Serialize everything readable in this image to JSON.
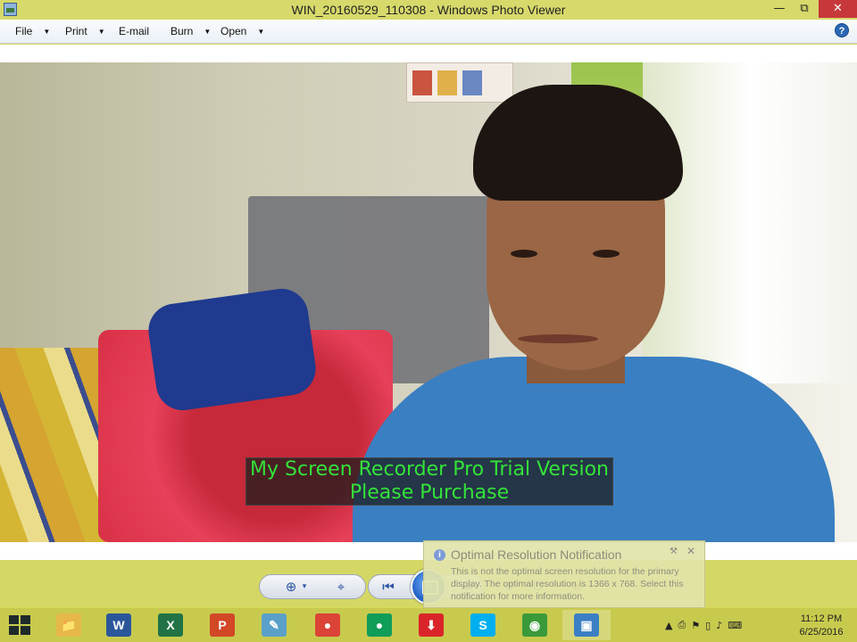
{
  "window": {
    "title": "WIN_20160529_110308 - Windows Photo Viewer",
    "minimize_glyph": "—",
    "maximize_glyph": "⧉",
    "close_glyph": "✕"
  },
  "menu": {
    "items": [
      {
        "label": "File",
        "has_arrow": true
      },
      {
        "label": "Print",
        "has_arrow": true
      },
      {
        "label": "E-mail",
        "has_arrow": false
      },
      {
        "label": "Burn",
        "has_arrow": true
      },
      {
        "label": "Open",
        "has_arrow": true
      }
    ],
    "arrow_glyph": "▼",
    "help_glyph": "?"
  },
  "watermark": {
    "line1": "My Screen Recorder Pro Trial Version",
    "line2": "Please Purchase"
  },
  "toolbar": {
    "zoom_icon": "⊕",
    "zoom_arrow": "▾",
    "fit_icon": "⌖",
    "prev_icon": "⏮",
    "next_icon": "⏭",
    "rotate_ccw_icon": "↺",
    "rotate_cw_icon": "↻",
    "delete_icon": "✕"
  },
  "notification": {
    "title": "Optimal Resolution Notification",
    "body": "This is not the optimal screen resolution for the primary display. The optimal resolution is 1366 x 768. Select this notification for more information.",
    "info_glyph": "i",
    "pin_glyph": "⚒",
    "close_glyph": "✕"
  },
  "taskbar": {
    "apps": [
      {
        "name": "file-explorer",
        "glyph": "📁",
        "color": "#e6b84a"
      },
      {
        "name": "word",
        "glyph": "W",
        "color": "#2b579a"
      },
      {
        "name": "excel",
        "glyph": "X",
        "color": "#217346"
      },
      {
        "name": "powerpoint",
        "glyph": "P",
        "color": "#d24726"
      },
      {
        "name": "notepad",
        "glyph": "✎",
        "color": "#5aa0c8"
      },
      {
        "name": "chrome",
        "glyph": "●",
        "color": "#db4437"
      },
      {
        "name": "chrome-2",
        "glyph": "●",
        "color": "#0f9d58"
      },
      {
        "name": "downloader",
        "glyph": "⬇",
        "color": "#d9252a"
      },
      {
        "name": "skype",
        "glyph": "S",
        "color": "#00aff0"
      },
      {
        "name": "screen-recorder",
        "glyph": "◉",
        "color": "#3a9a3a"
      },
      {
        "name": "photo-viewer",
        "glyph": "▣",
        "color": "#3b7fc4"
      }
    ],
    "tray": {
      "chevron": "▲",
      "icons": [
        "⎙",
        "⚑",
        "▯",
        "♪",
        "⌨"
      ],
      "time": "11:12 PM",
      "date": "6/25/2016"
    }
  }
}
